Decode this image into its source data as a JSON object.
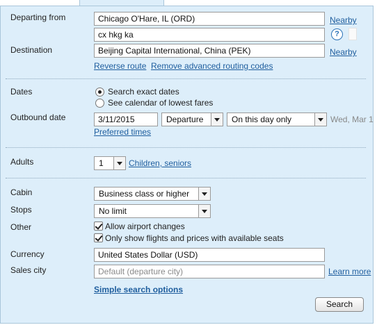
{
  "form": {
    "departing_from": {
      "label": "Departing from",
      "value": "Chicago O'Hare, IL (ORD)",
      "nearby_link": "Nearby",
      "routing_code": "cx hkg ka",
      "help_icon": "?"
    },
    "destination": {
      "label": "Destination",
      "value": "Beijing Capital International, China (PEK)",
      "nearby_link": "Nearby"
    },
    "reverse_route_link": "Reverse route",
    "remove_routing_link": "Remove advanced routing codes",
    "dates": {
      "label": "Dates",
      "options": [
        "Search exact dates",
        "See calendar of lowest fares"
      ],
      "selected_index": 0
    },
    "outbound": {
      "label": "Outbound date",
      "date_value": "3/11/2015",
      "time_type": "Departure",
      "flexibility": "On this day only",
      "day_hint": "Wed, Mar 1",
      "preferred_times_link": "Preferred times"
    },
    "adults": {
      "label": "Adults",
      "value": "1",
      "children_link": "Children, seniors"
    },
    "cabin": {
      "label": "Cabin",
      "value": "Business class or higher"
    },
    "stops": {
      "label": "Stops",
      "value": "No limit"
    },
    "other": {
      "label": "Other",
      "allow_airport_changes": "Allow airport changes",
      "only_available": "Only show flights and prices with available seats"
    },
    "currency": {
      "label": "Currency",
      "value": "United States Dollar (USD)"
    },
    "sales_city": {
      "label": "Sales city",
      "placeholder": "Default (departure city)",
      "learn_more_link": "Learn more"
    },
    "simple_search_link": "Simple search options",
    "search_button": "Search"
  }
}
